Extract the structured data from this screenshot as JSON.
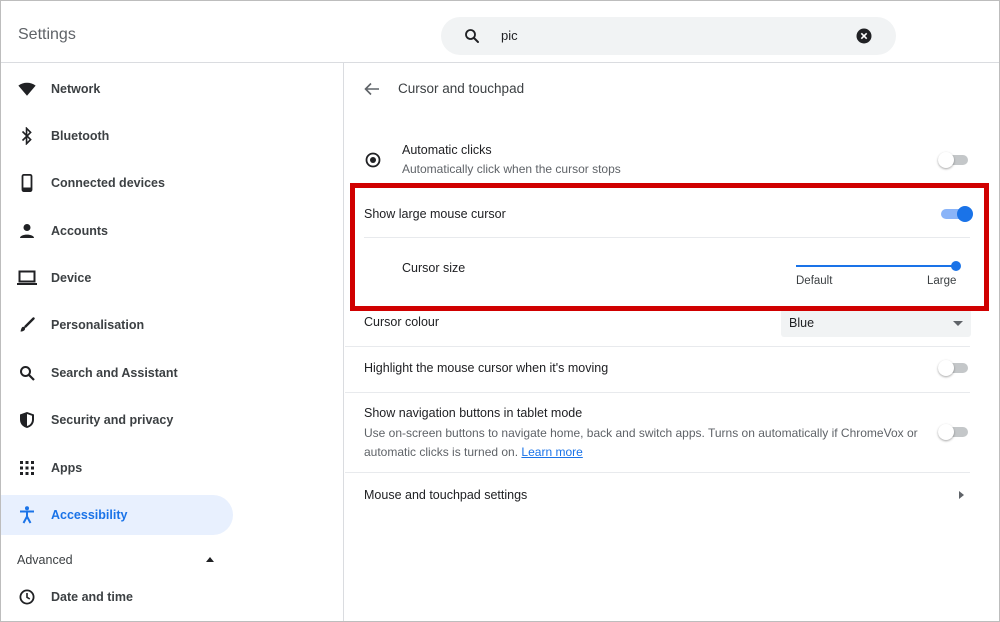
{
  "app": {
    "title": "Settings"
  },
  "search": {
    "value": "pic"
  },
  "sidebar": {
    "items": [
      {
        "label": "Network",
        "icon": "wifi-icon"
      },
      {
        "label": "Bluetooth",
        "icon": "bluetooth-icon"
      },
      {
        "label": "Connected devices",
        "icon": "phone-icon"
      },
      {
        "label": "Accounts",
        "icon": "person-icon"
      },
      {
        "label": "Device",
        "icon": "laptop-icon"
      },
      {
        "label": "Personalisation",
        "icon": "brush-icon"
      },
      {
        "label": "Search and Assistant",
        "icon": "search-icon"
      },
      {
        "label": "Security and privacy",
        "icon": "shield-icon"
      },
      {
        "label": "Apps",
        "icon": "apps-grid-icon"
      },
      {
        "label": "Accessibility",
        "icon": "accessibility-icon",
        "active": true
      }
    ],
    "advanced_label": "Advanced",
    "advanced_items": [
      {
        "label": "Date and time",
        "icon": "clock-icon"
      }
    ]
  },
  "main": {
    "page_title": "Cursor and touchpad",
    "automatic_clicks": {
      "title": "Automatic clicks",
      "subtitle": "Automatically click when the cursor stops",
      "enabled": false
    },
    "large_cursor": {
      "title": "Show large mouse cursor",
      "enabled": true
    },
    "cursor_size": {
      "title": "Cursor size",
      "min_label": "Default",
      "max_label": "Large",
      "value": 1.0
    },
    "cursor_colour": {
      "title": "Cursor colour",
      "selected": "Blue"
    },
    "highlight_cursor": {
      "title": "Highlight the mouse cursor when it's moving",
      "enabled": false
    },
    "nav_buttons": {
      "title": "Show navigation buttons in tablet mode",
      "description": "Use on-screen buttons to navigate home, back and switch apps. Turns on automatically if ChromeVox or automatic clicks is turned on.",
      "link": "Learn more",
      "enabled": false
    },
    "mouse_touchpad": {
      "title": "Mouse and touchpad settings"
    }
  },
  "colors": {
    "accent": "#1a73e8",
    "highlight": "#d00000"
  }
}
